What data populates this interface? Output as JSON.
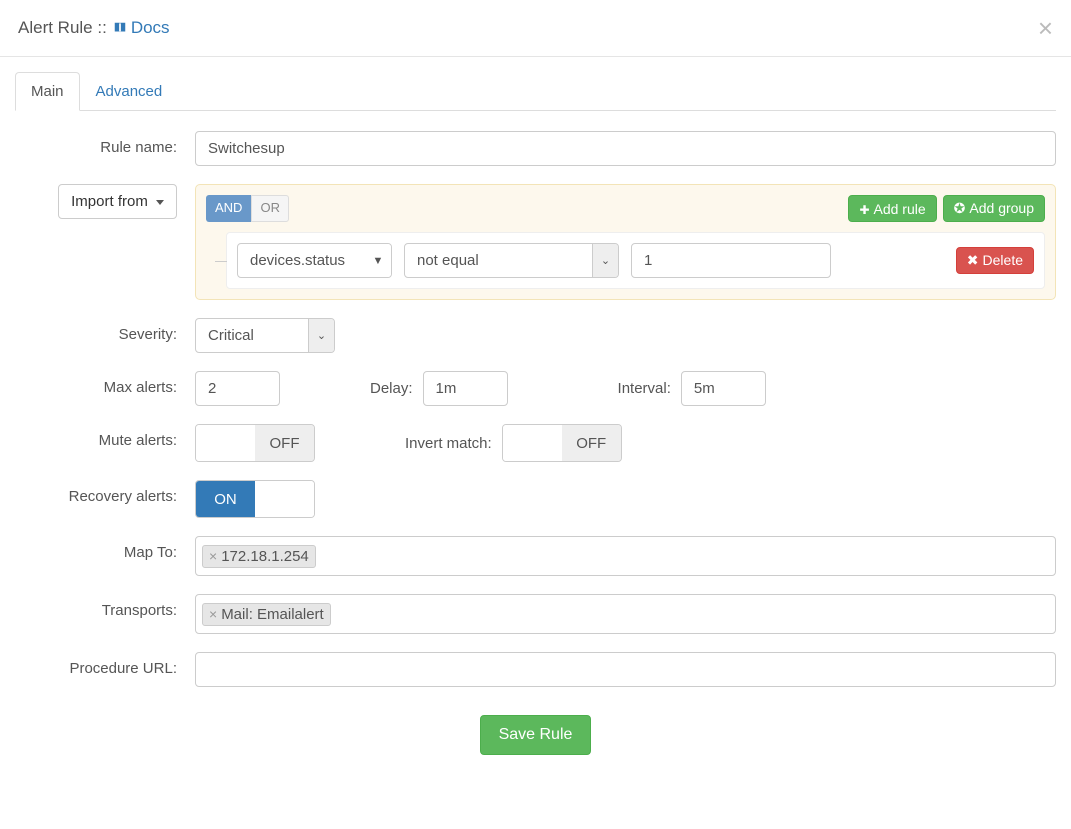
{
  "header": {
    "title_prefix": "Alert Rule :: ",
    "docs_link": "Docs"
  },
  "tabs": [
    {
      "label": "Main",
      "active": true
    },
    {
      "label": "Advanced",
      "active": false
    }
  ],
  "labels": {
    "rule_name": "Rule name:",
    "import_from": "Import from ",
    "severity": "Severity:",
    "max_alerts": "Max alerts:",
    "delay": "Delay:",
    "interval": "Interval:",
    "mute_alerts": "Mute alerts:",
    "invert_match": "Invert match:",
    "recovery_alerts": "Recovery alerts:",
    "map_to": "Map To:",
    "transports": "Transports:",
    "procedure_url": "Procedure URL:",
    "save": "Save Rule"
  },
  "query_builder": {
    "and": "AND",
    "or": "OR",
    "add_rule": "Add rule",
    "add_group": "Add group",
    "delete": "Delete",
    "rule": {
      "field": "devices.status",
      "operator": "not equal",
      "value": "1"
    }
  },
  "values": {
    "rule_name": "Switchesup",
    "severity": "Critical",
    "max_alerts": "2",
    "delay": "1m",
    "interval": "5m",
    "mute_alerts": "OFF",
    "invert_match": "OFF",
    "recovery_alerts": "ON",
    "map_to_tag": "172.18.1.254",
    "transports_tag": "Mail: Emailalert",
    "procedure_url": ""
  },
  "toggle_labels": {
    "on": "ON",
    "off": "OFF"
  }
}
